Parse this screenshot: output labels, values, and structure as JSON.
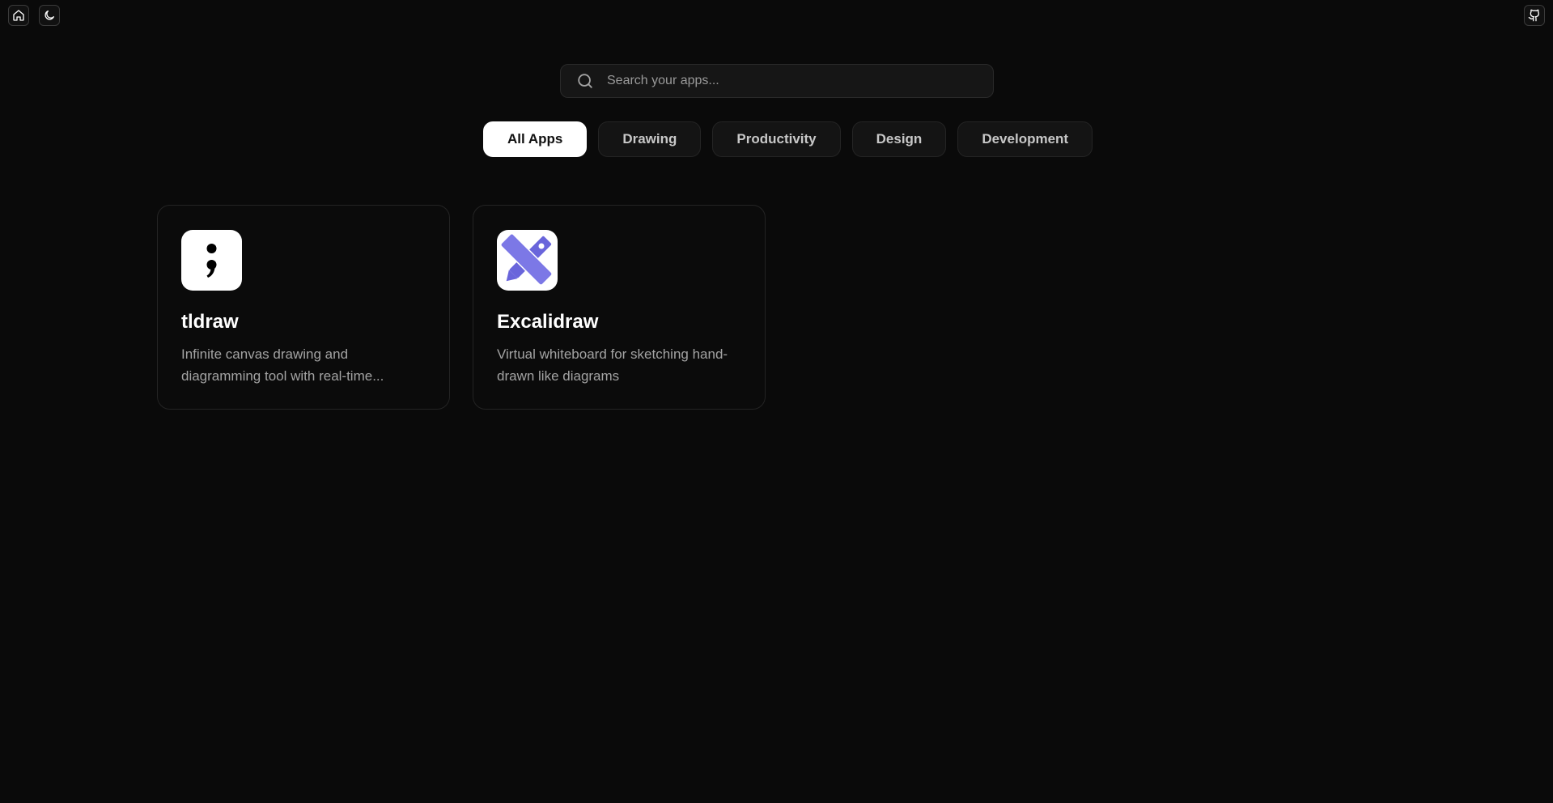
{
  "topbar": {
    "home_icon": "home-icon",
    "theme_icon": "moon-icon",
    "github_icon": "github-icon"
  },
  "search": {
    "placeholder": "Search your apps...",
    "value": ""
  },
  "tabs": [
    {
      "label": "All Apps",
      "active": true
    },
    {
      "label": "Drawing",
      "active": false
    },
    {
      "label": "Productivity",
      "active": false
    },
    {
      "label": "Design",
      "active": false
    },
    {
      "label": "Development",
      "active": false
    }
  ],
  "apps": [
    {
      "name": "tldraw",
      "description": "Infinite canvas drawing and diagramming tool with real-time...",
      "icon": "semicolon-logo-icon"
    },
    {
      "name": "Excalidraw",
      "description": "Virtual whiteboard for sketching hand-drawn like diagrams",
      "icon": "pen-ruler-logo-icon"
    }
  ],
  "colors": {
    "background": "#0a0a0a",
    "active_tab_bg": "#ffffff",
    "excalidraw_accent": "#6965db"
  }
}
